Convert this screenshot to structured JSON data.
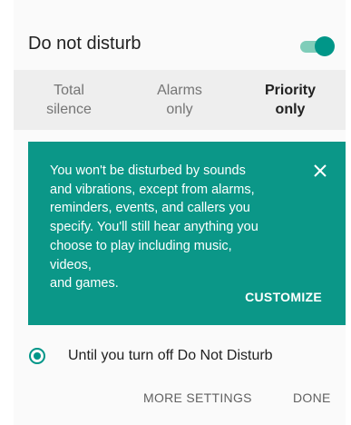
{
  "header": {
    "title": "Do not disturb",
    "toggle_on": true
  },
  "modes": [
    {
      "label_line1": "Total",
      "label_line2": "silence",
      "selected": false
    },
    {
      "label_line1": "Alarms",
      "label_line2": "only",
      "selected": false
    },
    {
      "label_line1": "Priority",
      "label_line2": "only",
      "selected": true
    }
  ],
  "info_card": {
    "lines": [
      "You won't be disturbed by sounds",
      "and vibrations, except from alarms,",
      "reminders, events, and callers you",
      "specify. You'll still hear anything you",
      "choose to play including music, videos,",
      "and games."
    ],
    "action_label": "CUSTOMIZE",
    "close_icon": "close-icon",
    "background_color": "#0b9788"
  },
  "duration": {
    "option_label": "Until you turn off Do Not Disturb",
    "selected": true
  },
  "footer": {
    "more_settings_label": "MORE SETTINGS",
    "done_label": "DONE"
  },
  "colors": {
    "accent": "#009688"
  }
}
